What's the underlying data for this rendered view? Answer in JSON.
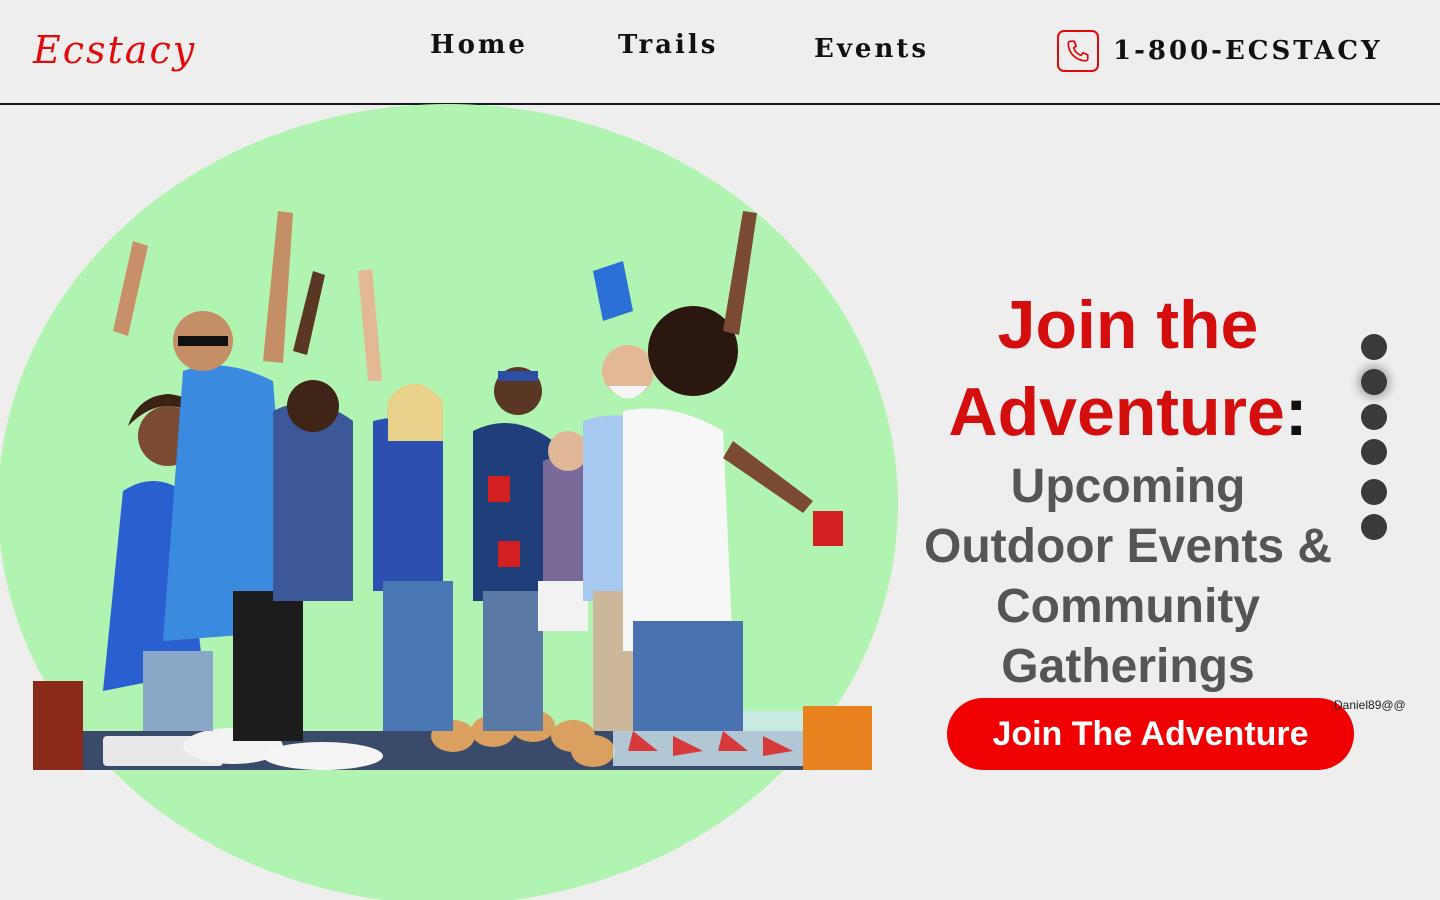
{
  "brand": {
    "name": "Ecstacy",
    "color": "#e00c0c"
  },
  "nav": {
    "items": [
      {
        "label": "Home"
      },
      {
        "label": "Trails"
      },
      {
        "label": "Events"
      }
    ],
    "phone": {
      "icon": "phone-icon",
      "label": "1-800-ECSTACY"
    }
  },
  "hero": {
    "headline_red_line1": "Join the",
    "headline_red_line2": "Adventure",
    "headline_colon": ":",
    "subheadline_lines": [
      "Upcoming",
      "Outdoor Events &",
      "Community",
      "Gatherings"
    ],
    "cta_label": "Join The Adventure",
    "watermark": "Daniel89@@",
    "image_alt": "group of friends celebrating outdoors",
    "colors": {
      "accent": "#e00c0c",
      "blob": "#b1f4b1",
      "subheadline": "#555555"
    }
  },
  "carousel": {
    "slide_count": 6,
    "active_index": 1
  }
}
